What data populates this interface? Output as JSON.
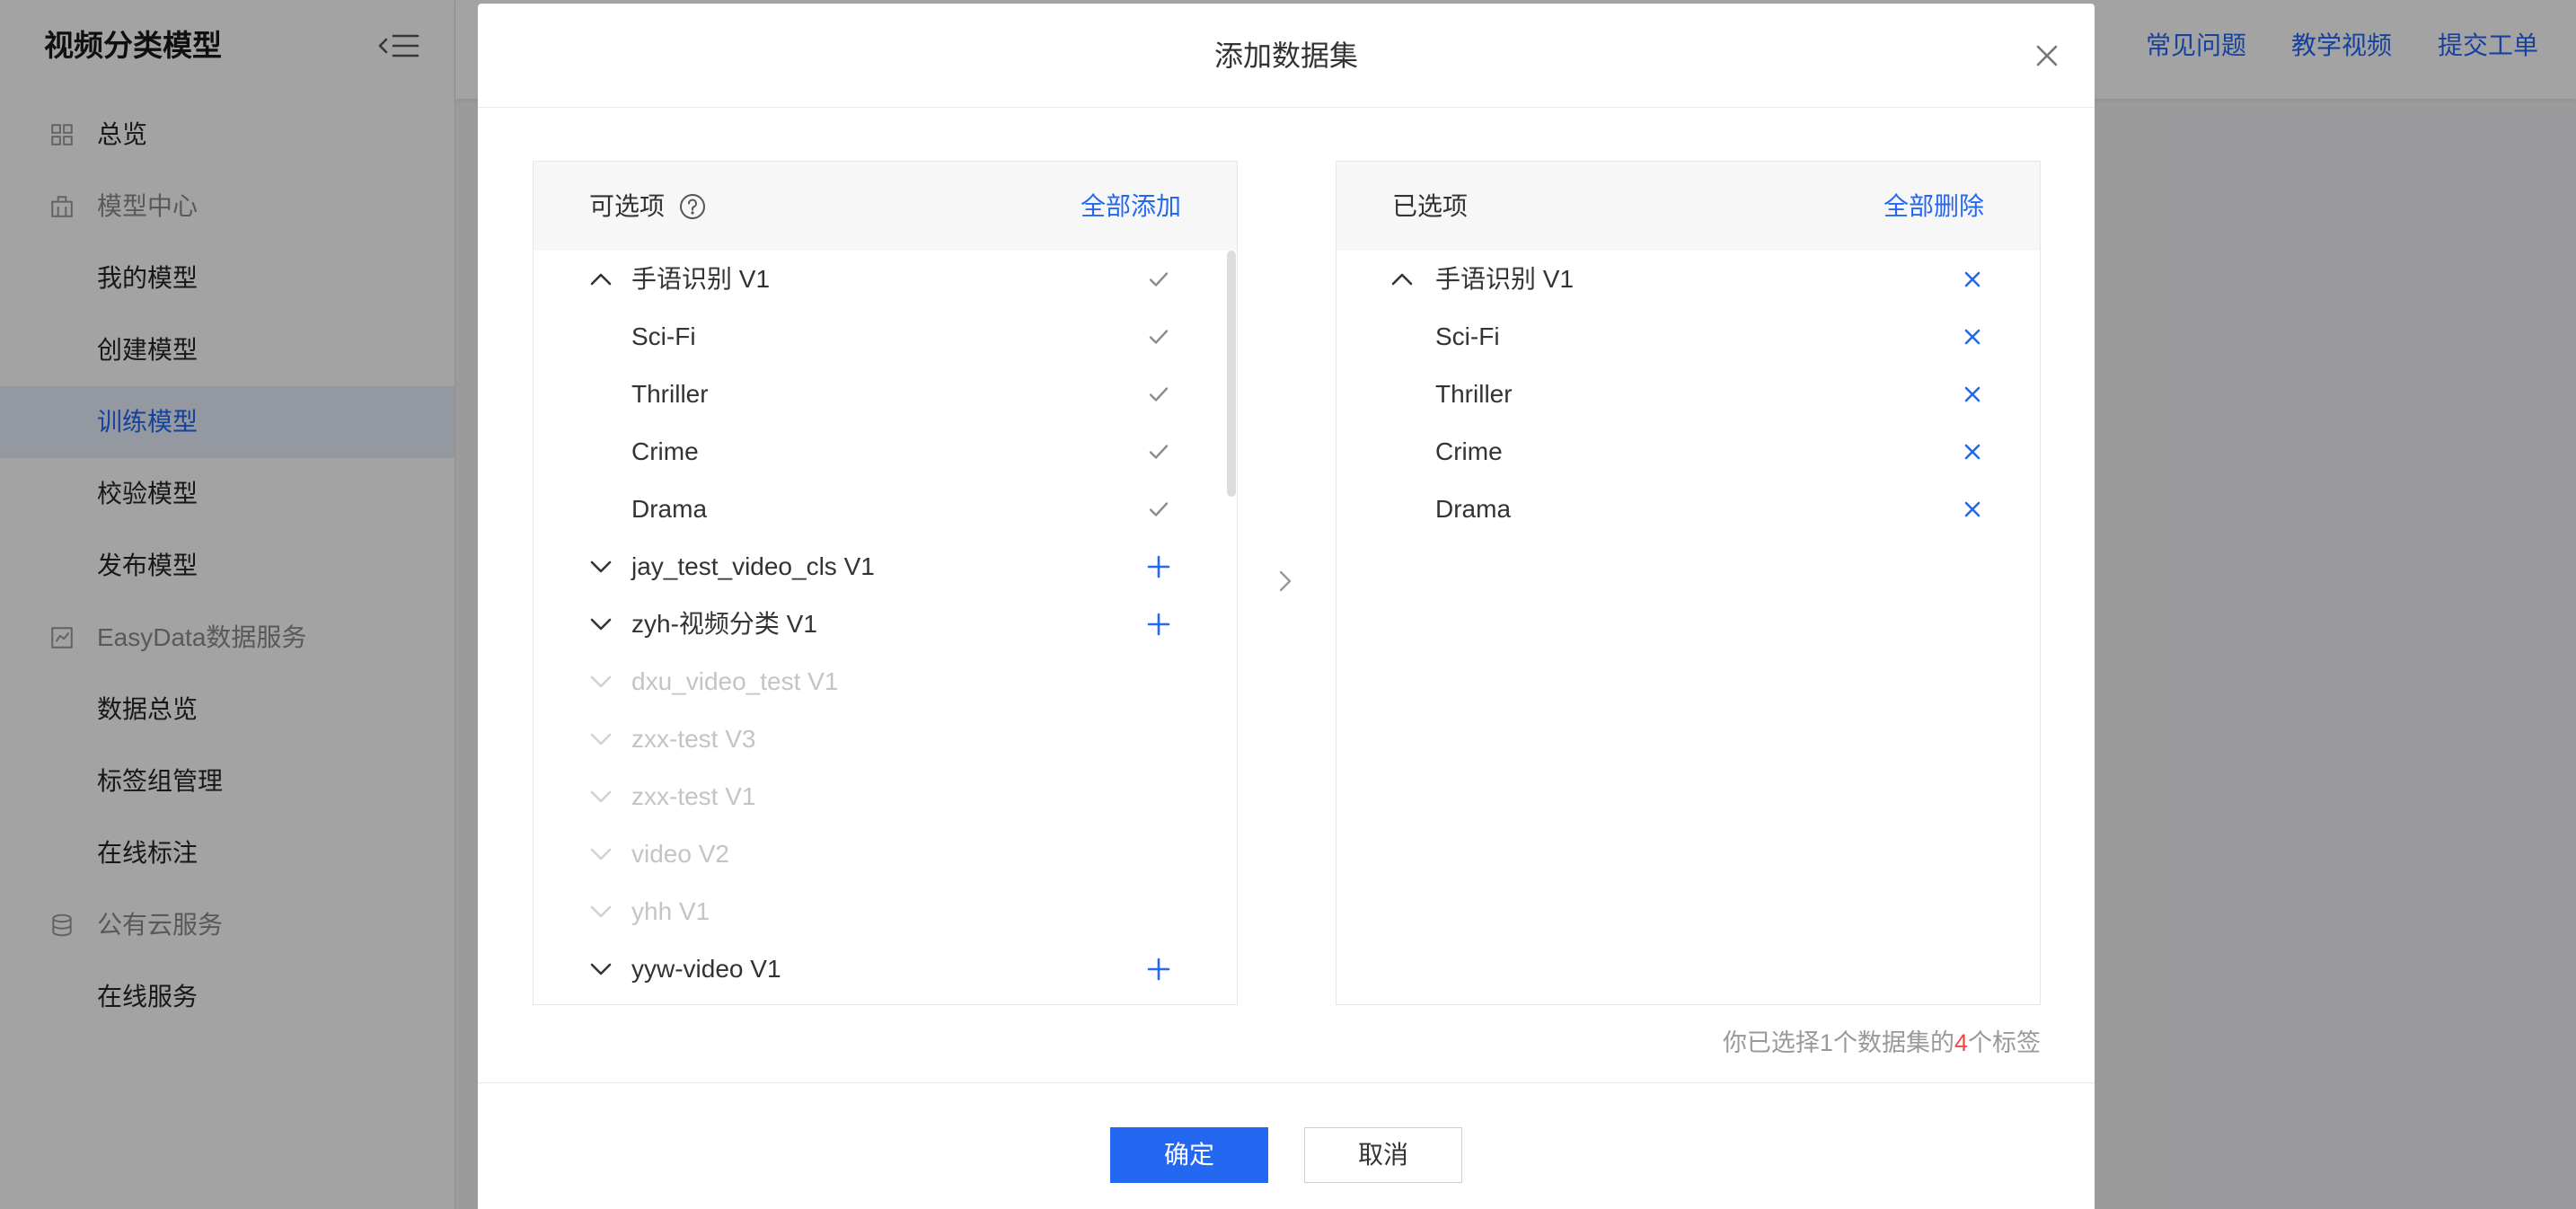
{
  "sidebar": {
    "title": "视频分类模型",
    "collapse_icon": "menu-fold-icon",
    "items": [
      {
        "label": "总览",
        "icon": "grid-icon"
      },
      {
        "label": "模型中心",
        "icon": "building-icon",
        "group": true
      },
      {
        "label": "我的模型"
      },
      {
        "label": "创建模型"
      },
      {
        "label": "训练模型",
        "active": true
      },
      {
        "label": "校验模型"
      },
      {
        "label": "发布模型"
      },
      {
        "label": "EasyData数据服务",
        "icon": "chart-icon",
        "group": true
      },
      {
        "label": "数据总览"
      },
      {
        "label": "标签组管理"
      },
      {
        "label": "在线标注"
      },
      {
        "label": "公有云服务",
        "icon": "database-icon",
        "group": true
      },
      {
        "label": "在线服务"
      }
    ]
  },
  "header": {
    "links": [
      "常见问题",
      "教学视频",
      "提交工单"
    ]
  },
  "modal": {
    "title": "添加数据集",
    "available": {
      "title": "可选项",
      "action": "全部添加",
      "items": [
        {
          "label": "手语识别 V1",
          "expanded": true,
          "action_icon": "check-icon"
        },
        {
          "label": "Sci-Fi",
          "child": true,
          "action_icon": "check-icon"
        },
        {
          "label": "Thriller",
          "child": true,
          "action_icon": "check-icon"
        },
        {
          "label": "Crime",
          "child": true,
          "action_icon": "check-icon"
        },
        {
          "label": "Drama",
          "child": true,
          "action_icon": "check-icon"
        },
        {
          "label": "jay_test_video_cls V1",
          "expanded": false,
          "action_icon": "plus-icon"
        },
        {
          "label": "zyh-视频分类 V1",
          "expanded": false,
          "action_icon": "plus-icon"
        },
        {
          "label": "dxu_video_test V1",
          "expanded": false,
          "disabled": true
        },
        {
          "label": "zxx-test V3",
          "expanded": false,
          "disabled": true
        },
        {
          "label": "zxx-test V1",
          "expanded": false,
          "disabled": true
        },
        {
          "label": "video V2",
          "expanded": false,
          "disabled": true
        },
        {
          "label": "yhh V1",
          "expanded": false,
          "disabled": true
        },
        {
          "label": "yyw-video V1",
          "expanded": false,
          "action_icon": "plus-icon"
        }
      ]
    },
    "selected": {
      "title": "已选项",
      "action": "全部删除",
      "items": [
        {
          "label": "手语识别 V1",
          "expanded": true,
          "action_icon": "close-icon"
        },
        {
          "label": "Sci-Fi",
          "child": true,
          "action_icon": "close-icon"
        },
        {
          "label": "Thriller",
          "child": true,
          "action_icon": "close-icon"
        },
        {
          "label": "Crime",
          "child": true,
          "action_icon": "close-icon"
        },
        {
          "label": "Drama",
          "child": true,
          "action_icon": "close-icon"
        }
      ]
    },
    "summary": {
      "prefix": "你已选择1个数据集的",
      "count": "4",
      "suffix": "个标签"
    },
    "confirm": "确定",
    "cancel": "取消"
  },
  "colors": {
    "accent": "#2468f2",
    "danger": "#f04a48",
    "disabled": "#c4c4c4",
    "muted": "#999999"
  }
}
